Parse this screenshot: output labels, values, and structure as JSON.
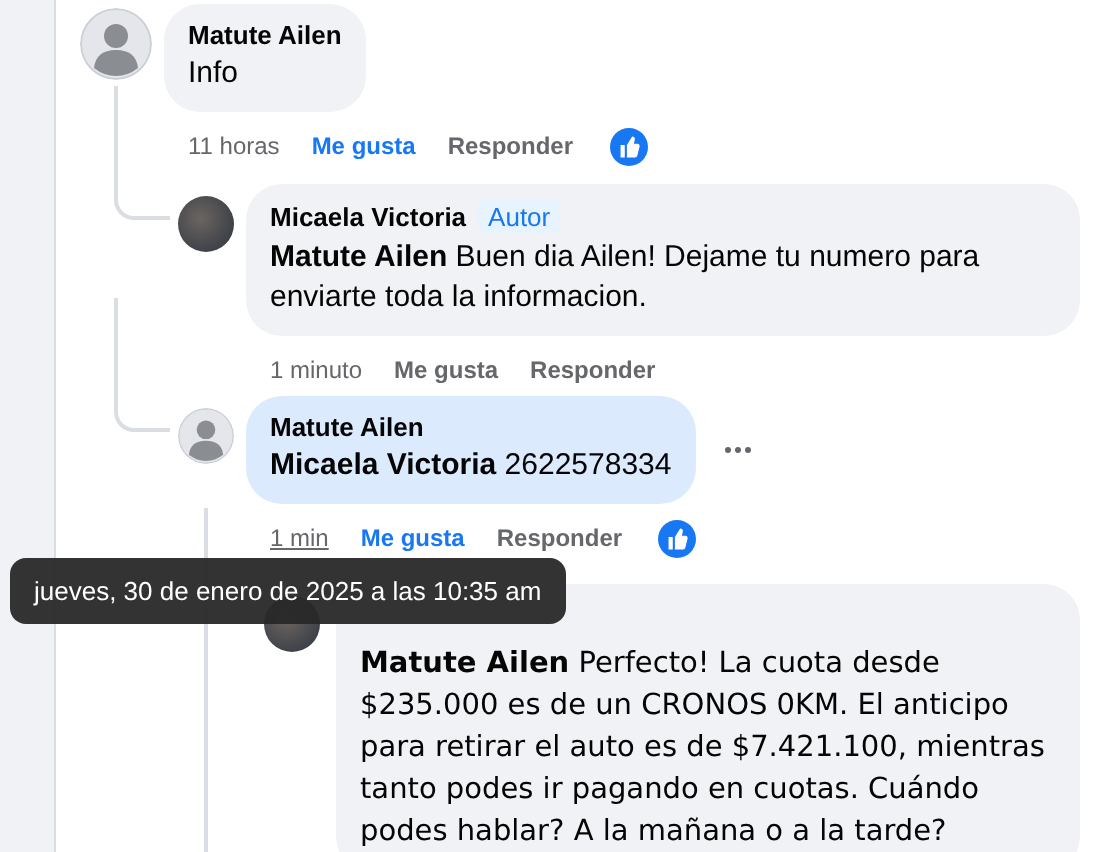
{
  "comments": [
    {
      "author": "Matute Ailen",
      "avatar": {
        "kind": "silhouette"
      },
      "text": "Info",
      "highlighted": false,
      "time": "11 horas",
      "time_hovered": false,
      "like_label": "Me gusta",
      "liked": true,
      "reply_label": "Responder",
      "menu_visible": false,
      "replies": [
        {
          "author": "Micaela Victoria",
          "badge": "Autor",
          "avatar": {
            "kind": "photo"
          },
          "text": "**Matute Ailen** Buen dia Ailen! Dejame tu numero para enviarte toda la informacion.",
          "highlighted": false,
          "time": "1 minuto",
          "time_hovered": false,
          "like_label": "Me gusta",
          "liked": false,
          "reply_label": "Responder",
          "menu_visible": false
        },
        {
          "author": "Matute Ailen",
          "avatar": {
            "kind": "silhouette"
          },
          "text": "**Micaela Victoria** 2622578334",
          "highlighted": true,
          "time": "1 min",
          "time_hovered": true,
          "like_label": "Me gusta",
          "liked": true,
          "reply_label": "Responder",
          "menu_visible": true,
          "tooltip": "jueves, 30 de enero de 2025 a las 10:35 am",
          "replies": [
            {
              "avatar": {
                "kind": "photo"
              },
              "text": "**Matute Ailen** Perfecto! La cuota desde $235.000 es de un CRONOS 0KM. El anticipo para retirar el auto es de $7.421.100, mientras tanto podes ir pagando en cuotas. Cuándo podes hablar? A la mañana o a la tarde?",
              "highlighted": false
            }
          ]
        }
      ]
    }
  ]
}
